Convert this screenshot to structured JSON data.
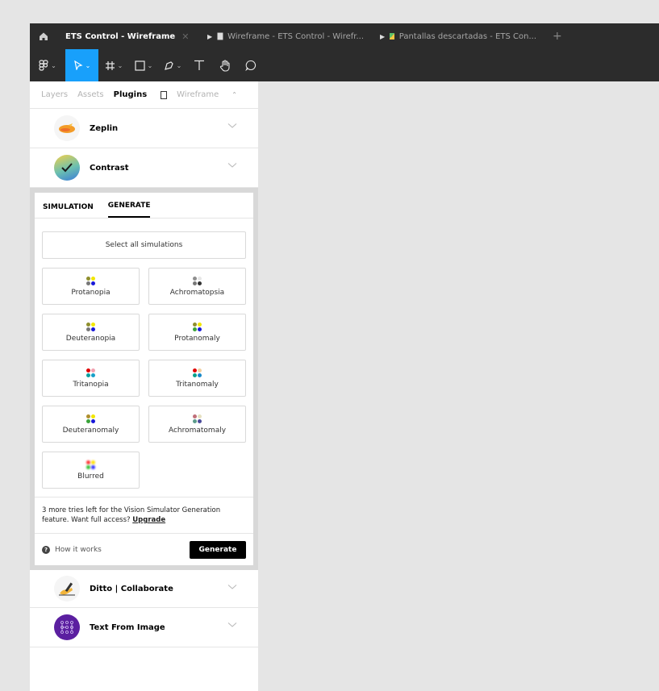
{
  "tabs": [
    {
      "label": "ETS Control - Wireframe",
      "active": true
    },
    {
      "label": "Wireframe - ETS Control - Wirefr...",
      "icon": "file-icon"
    },
    {
      "label": "Pantallas descartadas - ETS Con...",
      "icon": "image-icon"
    }
  ],
  "panel": {
    "tabs": [
      "Layers",
      "Assets",
      "Plugins"
    ],
    "page": "Wireframe"
  },
  "plugins_top": [
    {
      "name": "Zeplin",
      "icon": "zeplin-icon"
    },
    {
      "name": "Contrast",
      "icon": "contrast-icon"
    }
  ],
  "contrast": {
    "tabs": [
      "SIMULATION",
      "GENERATE"
    ],
    "active_tab": "GENERATE",
    "select_all": "Select all simulations",
    "simulations": [
      {
        "label": "Protanopia",
        "dots": [
          "#8f8f2e",
          "#f2e600",
          "#777777",
          "#1818d8"
        ]
      },
      {
        "label": "Achromatopsia",
        "dots": [
          "#8f8f8f",
          "#e6e6e6",
          "#777777",
          "#333333"
        ]
      },
      {
        "label": "Deuteranopia",
        "dots": [
          "#8f8f2e",
          "#f2e600",
          "#777777",
          "#1818d8"
        ]
      },
      {
        "label": "Protanomaly",
        "dots": [
          "#8f8f2e",
          "#f2e600",
          "#3aa33a",
          "#1818d8"
        ]
      },
      {
        "label": "Tritanopia",
        "dots": [
          "#e00000",
          "#f2a0b0",
          "#0aa0a0",
          "#18a0c8"
        ]
      },
      {
        "label": "Tritanomaly",
        "dots": [
          "#e00000",
          "#f2d0a0",
          "#0aa08a",
          "#1888c8"
        ]
      },
      {
        "label": "Deuteranomaly",
        "dots": [
          "#b08f2e",
          "#f2e600",
          "#3aa33a",
          "#1818d8"
        ]
      },
      {
        "label": "Achromatomaly",
        "dots": [
          "#c0707a",
          "#e6e0c0",
          "#5a9a8a",
          "#4a4a9a"
        ]
      },
      {
        "label": "Blurred",
        "dots": [
          "#ff3030",
          "#ffe000",
          "#30c030",
          "#3030ff"
        ],
        "blur": true
      }
    ],
    "notice_text": "3 more tries left for the Vision Simulator Generation feature. Want full access? ",
    "upgrade_label": "Upgrade",
    "how_it_works": "How it works",
    "generate_label": "Generate"
  },
  "plugins_bottom": [
    {
      "name": "Ditto | Collaborate",
      "icon": "writing-hand-icon"
    },
    {
      "name": "Text From Image",
      "icon": "text-from-image-icon"
    }
  ]
}
